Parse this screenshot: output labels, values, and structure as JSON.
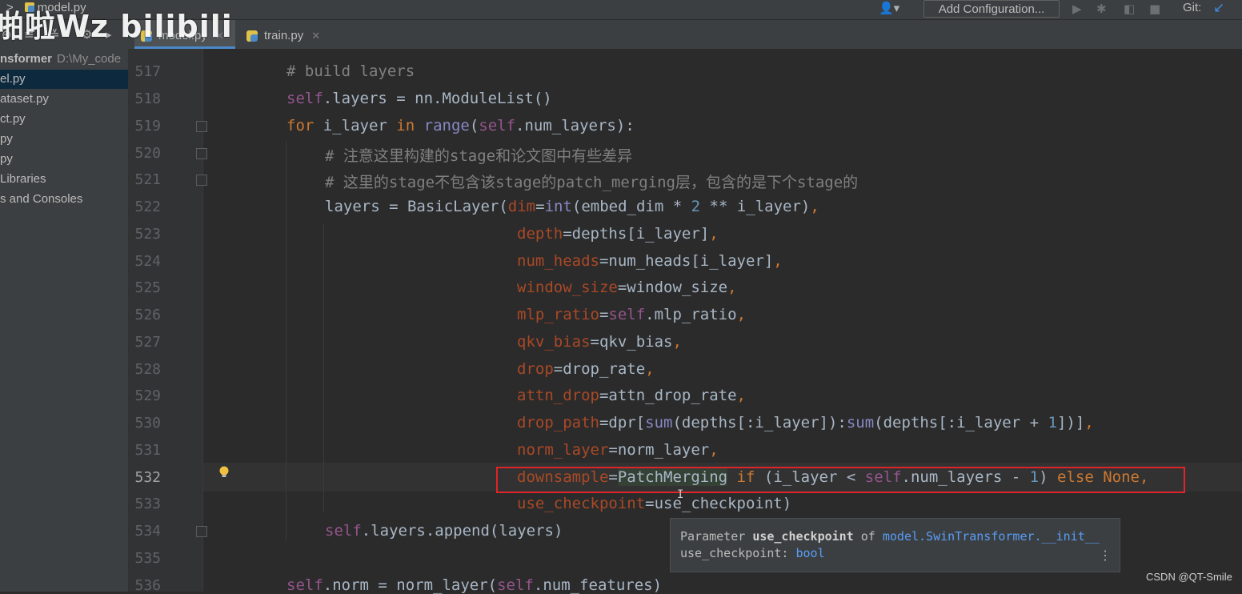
{
  "window": {
    "breadcrumb_file": "model.py",
    "watermark": "啪啦Wz bilibili",
    "add_configuration": "Add Configuration...",
    "git_label": "Git:"
  },
  "tabs": [
    {
      "label": "model.py",
      "active": true
    },
    {
      "label": "train.py",
      "active": false
    }
  ],
  "sidebar": {
    "project_name": "nsformer",
    "project_path": "D:\\My_code",
    "items": [
      {
        "label": "el.py",
        "selected": true
      },
      {
        "label": "ataset.py",
        "selected": false
      },
      {
        "label": "ct.py",
        "selected": false
      },
      {
        "label": "py",
        "selected": false
      },
      {
        "label": "py",
        "selected": false
      },
      {
        "label": "Libraries",
        "selected": false
      },
      {
        "label": "s and Consoles",
        "selected": false
      }
    ]
  },
  "editor": {
    "current_line": "532",
    "line_numbers": [
      "517",
      "518",
      "519",
      "520",
      "521",
      "522",
      "523",
      "524",
      "525",
      "526",
      "527",
      "528",
      "529",
      "530",
      "531",
      "532",
      "533",
      "534",
      "535",
      "536"
    ],
    "comment_517": "# build layers",
    "comment_520": "# 注意这里构建的stage和论文图中有些差异",
    "comment_521": "# 这里的stage不包含该stage的patch_merging层，包含的是下个stage的"
  },
  "tooltip": {
    "prefix": "Parameter ",
    "param": "use_checkpoint",
    "of": " of ",
    "target": "model.SwinTransformer.__init__",
    "line2_name": "use_checkpoint: ",
    "line2_type": "bool",
    "more_icon": "more-vertical-icon"
  },
  "footer_credit": "CSDN @QT-Smile",
  "colors": {
    "keyword": "#cc7832",
    "self": "#94558d",
    "builtin": "#8888c6",
    "comment": "#808080",
    "param": "#aa4926",
    "number": "#6897bb",
    "highlight_box": "#e0242b"
  }
}
